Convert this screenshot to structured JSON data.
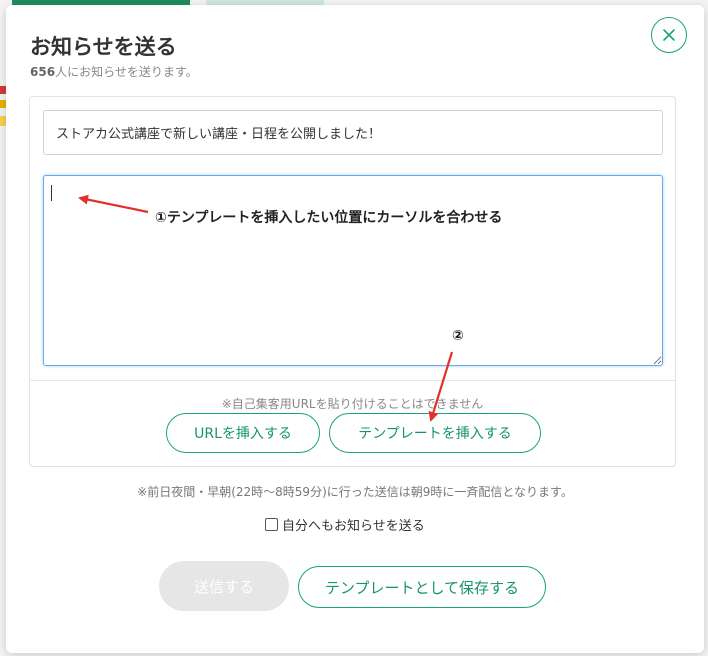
{
  "modal": {
    "title": "お知らせを送る",
    "subtitle_count": "656",
    "subtitle_text": "人にお知らせを送ります。"
  },
  "form": {
    "subject_value": "ストアカ公式講座で新しい講座・日程を公開しました！",
    "body_value": "",
    "url_note": "※自己集客用URLを貼り付けることはできません",
    "insert_url_label": "URLを挿入する",
    "insert_template_label": "テンプレートを挿入する"
  },
  "footer": {
    "night_note": "※前日夜間・早朝(22時〜8時59分)に行った送信は朝9時に一斉配信となります。",
    "self_notify_label": "自分へもお知らせを送る",
    "self_notify_checked": false,
    "send_label": "送信する",
    "save_template_label": "テンプレートとして保存する"
  },
  "annotations": {
    "step1": "①テンプレートを挿入したい位置にカーソルを合わせる",
    "step2": "②"
  },
  "colors": {
    "accent": "#1aa37a",
    "arrow": "#e0322b",
    "disabled_button": "#e6e6e6"
  },
  "icons": {
    "close": "close-icon"
  }
}
